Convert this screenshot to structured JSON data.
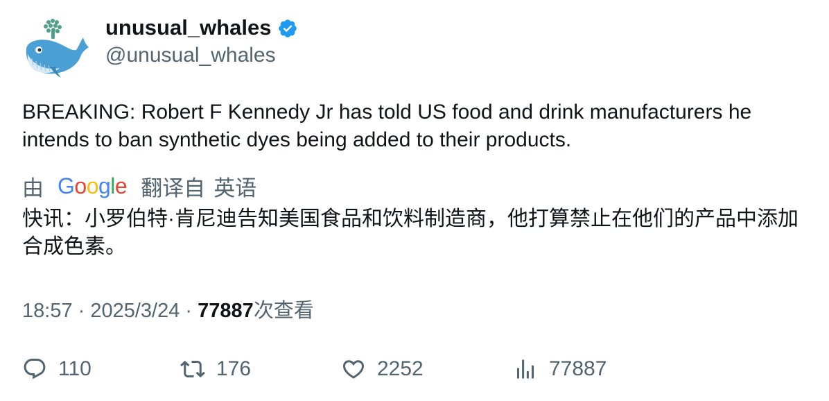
{
  "author": {
    "display_name": "unusual_whales",
    "handle": "@unusual_whales",
    "verified": true,
    "avatar_icon": "whale-logo-icon"
  },
  "tweet": {
    "text": "BREAKING: Robert F Kennedy Jr has told US food and drink manufacturers he intends to ban synthetic dyes being added to their products."
  },
  "translation": {
    "by_label": "由",
    "provider": "Google",
    "translated_from_label": "翻译自",
    "source_language": "英语",
    "translated_text": "快讯：小罗伯特·肯尼迪告知美国食品和饮料制造商，他打算禁止在他们的产品中添加合成色素。"
  },
  "meta": {
    "time": "18:57",
    "separator": " · ",
    "date": "2025/3/24",
    "views_count": "77887",
    "views_label": "次查看"
  },
  "actions": {
    "replies": "110",
    "reposts": "176",
    "likes": "2252",
    "views": "77887"
  },
  "colors": {
    "text_primary": "#0f1419",
    "text_secondary": "#536471",
    "verified_blue": "#1d9bf0",
    "google_blue": "#4285F4",
    "google_red": "#EA4335",
    "google_yellow": "#FBBC05",
    "google_green": "#34A853"
  }
}
